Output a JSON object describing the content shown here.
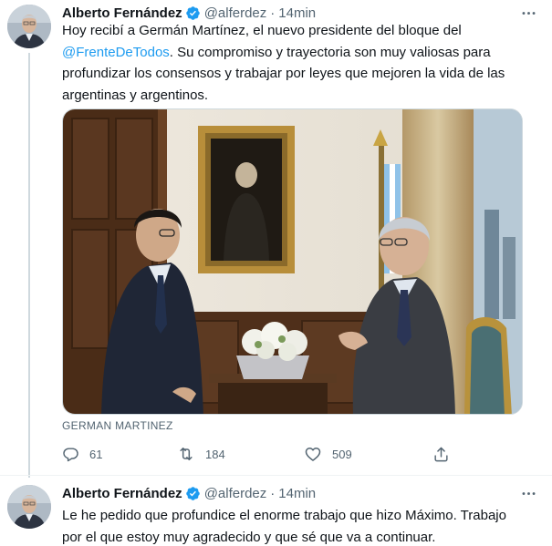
{
  "tweets": [
    {
      "author": "Alberto Fernández",
      "handle": "@alferdez",
      "separator": "·",
      "time": "14min",
      "verified": true,
      "text_lines": [
        {
          "before": "Hoy recibí a Germán Martínez, el nuevo presidente del bloque del",
          "mention": "",
          "after": ""
        },
        {
          "before": "",
          "mention": "@FrenteDeTodos",
          "after": ". Su compromiso y trayectoria son muy valiosas para"
        },
        {
          "before": "profundizar los consensos y trabajar por leyes que mejoren la vida de las",
          "mention": "",
          "after": ""
        },
        {
          "before": "argentinas y argentinos.",
          "mention": "",
          "after": ""
        }
      ],
      "media_tag": "GERMAN MARTINEZ",
      "actions": {
        "replies": "61",
        "retweets": "184",
        "likes": "509"
      }
    },
    {
      "author": "Alberto Fernández",
      "handle": "@alferdez",
      "separator": "·",
      "time": "14min",
      "verified": true,
      "text_lines": [
        {
          "before": "Le he pedido que profundice el enorme trabajo que hizo Máximo. Trabajo",
          "mention": "",
          "after": ""
        },
        {
          "before": "por el que estoy muy agradecido y que sé que va a continuar.",
          "mention": "",
          "after": ""
        }
      ]
    }
  ],
  "icons": {
    "more": "more-horizontal-icon",
    "verified": "verified-badge-icon",
    "reply": "reply-icon",
    "retweet": "retweet-icon",
    "like": "heart-icon",
    "share": "share-icon"
  },
  "colors": {
    "accent": "#1d9bf0",
    "muted": "#536471",
    "text": "#0f1419",
    "divider": "#cfd9de"
  }
}
